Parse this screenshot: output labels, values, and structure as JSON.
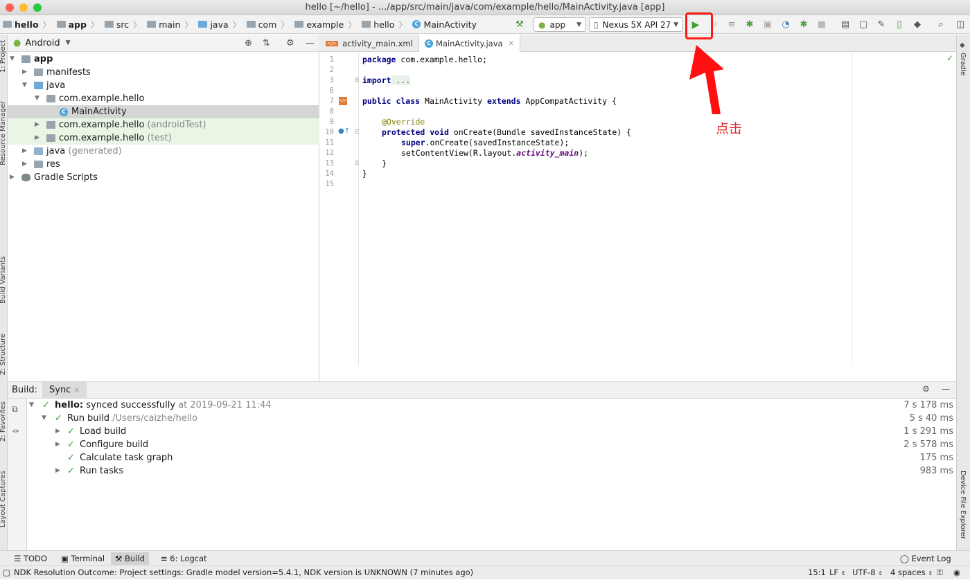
{
  "window": {
    "title": "hello [~/hello] - .../app/src/main/java/com/example/hello/MainActivity.java [app]"
  },
  "breadcrumbs": [
    "hello",
    "app",
    "src",
    "main",
    "java",
    "com",
    "example",
    "hello",
    "MainActivity"
  ],
  "run_config": {
    "label": "app"
  },
  "device": {
    "label": "Nexus 5X API 27"
  },
  "toolbar_icons": [
    "hammer-icon",
    "run-icon",
    "apply-changes-icon",
    "coverage-icon",
    "debug-icon",
    "attach-icon",
    "profile-icon",
    "debug-attach-icon",
    "stop-icon",
    "sync-icon",
    "structure-icon",
    "avd-icon",
    "sdk-icon",
    "device-icon",
    "search-icon"
  ],
  "project_panel": {
    "view": "Android",
    "tree": [
      {
        "label": "app",
        "bold": true
      },
      {
        "label": "manifests"
      },
      {
        "label": "java"
      },
      {
        "label": "com.example.hello"
      },
      {
        "label": "MainActivity"
      },
      {
        "label": "com.example.hello",
        "suffix": "(androidTest)"
      },
      {
        "label": "com.example.hello",
        "suffix": "(test)"
      },
      {
        "label": "java",
        "suffix": "(generated)"
      },
      {
        "label": "res"
      },
      {
        "label": "Gradle Scripts"
      }
    ]
  },
  "editor": {
    "tabs": [
      "activity_main.xml",
      "MainActivity.java"
    ],
    "line_numbers": [
      "1",
      "2",
      "3",
      "6",
      "7",
      "8",
      "9",
      "10",
      "11",
      "12",
      "13",
      "14",
      "15"
    ],
    "code": {
      "l1_kw": "package",
      "l1_rest": " com.example.hello;",
      "l3_kw": "import",
      "l3_rest": " ...",
      "l7_kw1": "public class",
      "l7_mid": " MainActivity ",
      "l7_kw2": "extends",
      "l7_rest": " AppCompatActivity {",
      "l9": "@Override",
      "l10_kw": "protected void",
      "l10_rest": " onCreate(Bundle savedInstanceState) {",
      "l11_kw": "super",
      "l11_rest": ".onCreate(savedInstanceState);",
      "l12_a": "setContentView(R.layout.",
      "l12_b": "activity_main",
      "l12_c": ");",
      "l13": "}",
      "l14": "}"
    }
  },
  "build_panel": {
    "label": "Build:",
    "tab": "Sync",
    "rows": [
      {
        "bold": "hello:",
        "text": " synced successfully",
        "extra": " at 2019-09-21 11:44",
        "time": "7 s 178 ms"
      },
      {
        "text": "Run build",
        "extra": " /Users/caizhe/hello",
        "time": "5 s 40 ms"
      },
      {
        "text": "Load build",
        "time": "1 s 291 ms"
      },
      {
        "text": "Configure build",
        "time": "2 s 578 ms"
      },
      {
        "text": "Calculate task graph",
        "time": "175 ms"
      },
      {
        "text": "Run tasks",
        "time": "983 ms"
      }
    ]
  },
  "side_tabs": {
    "left": [
      "1: Project",
      "Resource Manager",
      "Build Variants",
      "Z: Structure",
      "2: Favorites",
      "Layout Captures"
    ],
    "right": [
      "Gradle",
      "Device File Explorer"
    ]
  },
  "bottom_tools": [
    "TODO",
    "Terminal",
    "Build",
    "6: Logcat",
    "Event Log"
  ],
  "status": {
    "message": "NDK Resolution Outcome: Project settings: Gradle model version=5.4.1, NDK version is UNKNOWN (7 minutes ago)",
    "position": "15:1",
    "line_sep": "LF",
    "encoding": "UTF-8",
    "indent": "4 spaces"
  },
  "annotation": {
    "text": "点击",
    "color": "#e8262b"
  }
}
